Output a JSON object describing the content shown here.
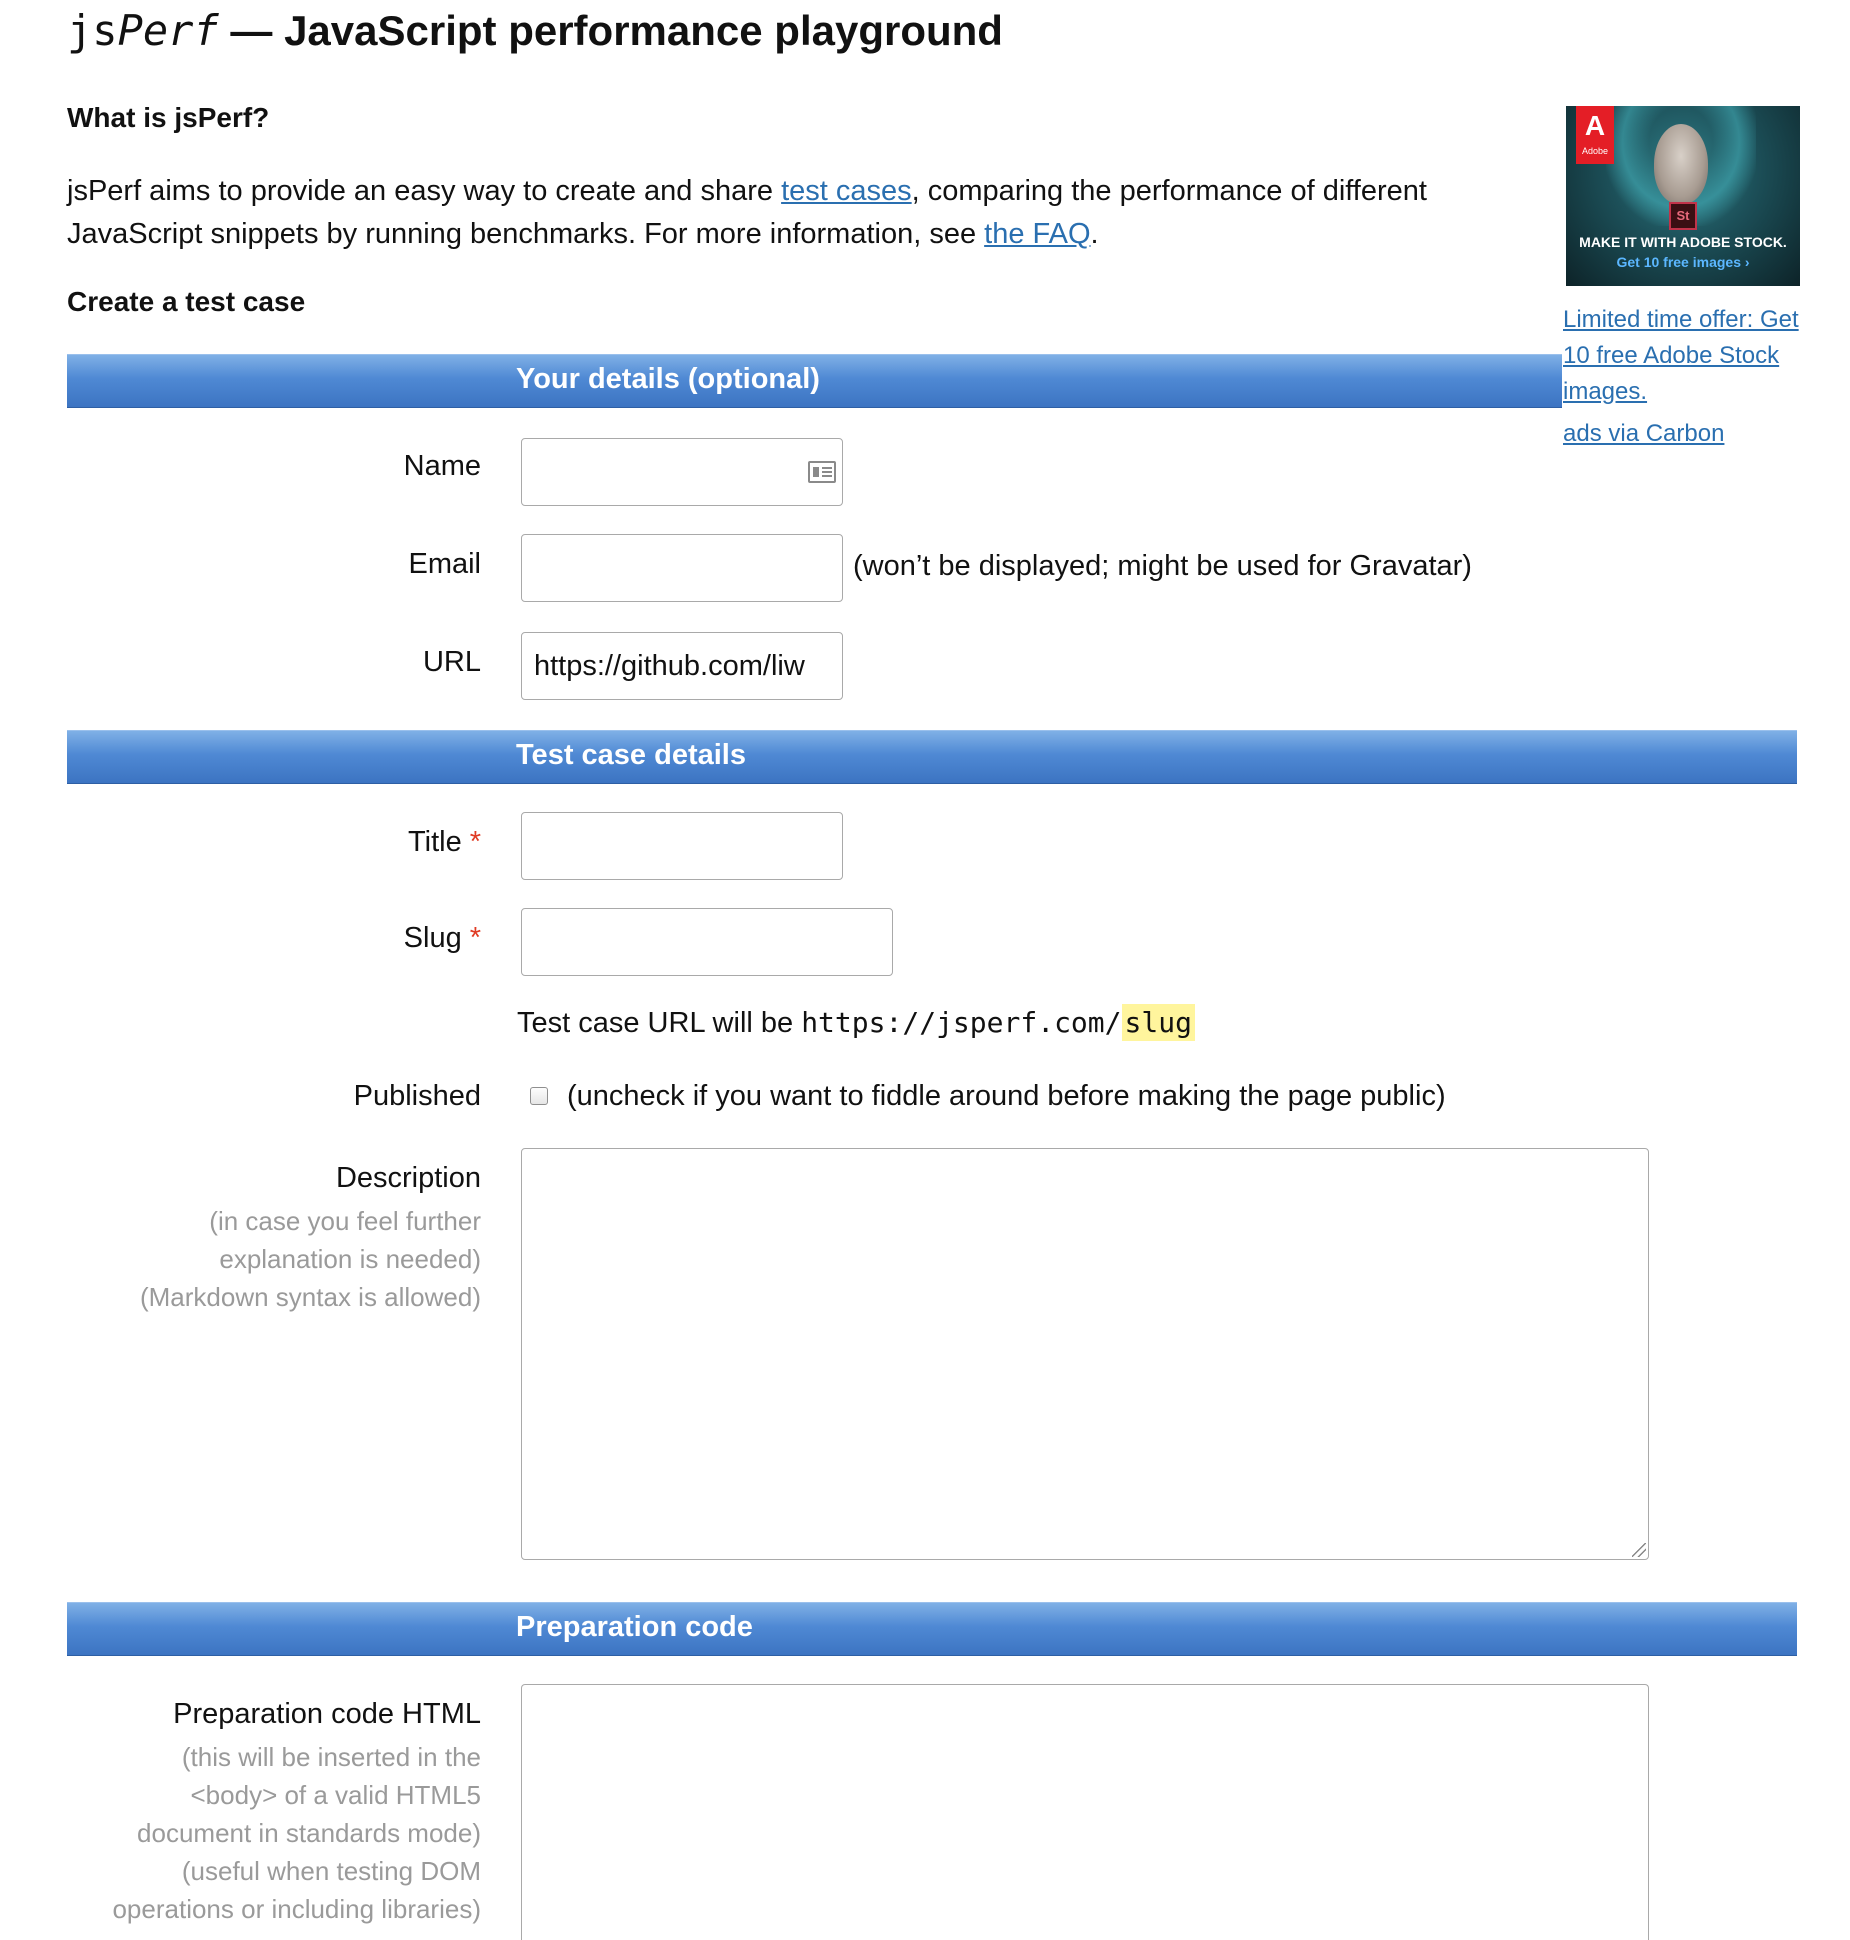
{
  "header": {
    "brand_plain": "js",
    "brand_italic": "Perf",
    "title_rest": " — JavaScript performance playground"
  },
  "intro": {
    "heading": "What is jsPerf?",
    "text_1": "jsPerf aims to provide an easy way to create and share ",
    "link_test_cases": "test cases",
    "text_2": ", comparing the performance of different JavaScript snippets by running benchmarks. For more information, see ",
    "link_faq": "the FAQ",
    "text_3": "."
  },
  "create_heading": "Create a test case",
  "ad": {
    "logo_letter": "A",
    "logo_word": "Adobe",
    "badge": "St",
    "line1": "MAKE IT WITH ADOBE STOCK.",
    "line2": "Get 10 free images ›",
    "offer_link": "Limited time offer: Get 10 free Adobe Stock images.",
    "via_link": "ads via Carbon"
  },
  "sections": {
    "your_details": "Your details (optional)",
    "test_case_details": "Test case details",
    "preparation_code": "Preparation code"
  },
  "form": {
    "name_label": "Name",
    "name_value": "",
    "email_label": "Email",
    "email_value": "",
    "email_note": "(won’t be displayed; might be used for Gravatar)",
    "url_label": "URL",
    "url_value": "https://github.com/liw",
    "title_label": "Title",
    "title_value": "",
    "slug_label": "Slug",
    "slug_value": "",
    "required_mark": "*",
    "slug_url_prefix": "Test case URL will be ",
    "slug_url_base": "https://jsperf.com/",
    "slug_url_slug": "slug",
    "published_label": "Published",
    "published_checked": false,
    "published_note": "(uncheck if you want to fiddle around before making the page public)",
    "description_label": "Description",
    "description_hint_1": "(in case you feel further",
    "description_hint_2": "explanation is needed)",
    "description_hint_3": "(Markdown syntax is allowed)",
    "prep_html_label": "Preparation code HTML",
    "prep_html_hint_1": "(this will be inserted in the",
    "prep_html_hint_2": "<body> of a valid HTML5",
    "prep_html_hint_3": "document in standards mode)",
    "prep_html_hint_4": "(useful when testing DOM",
    "prep_html_hint_5": "operations or including libraries)"
  }
}
